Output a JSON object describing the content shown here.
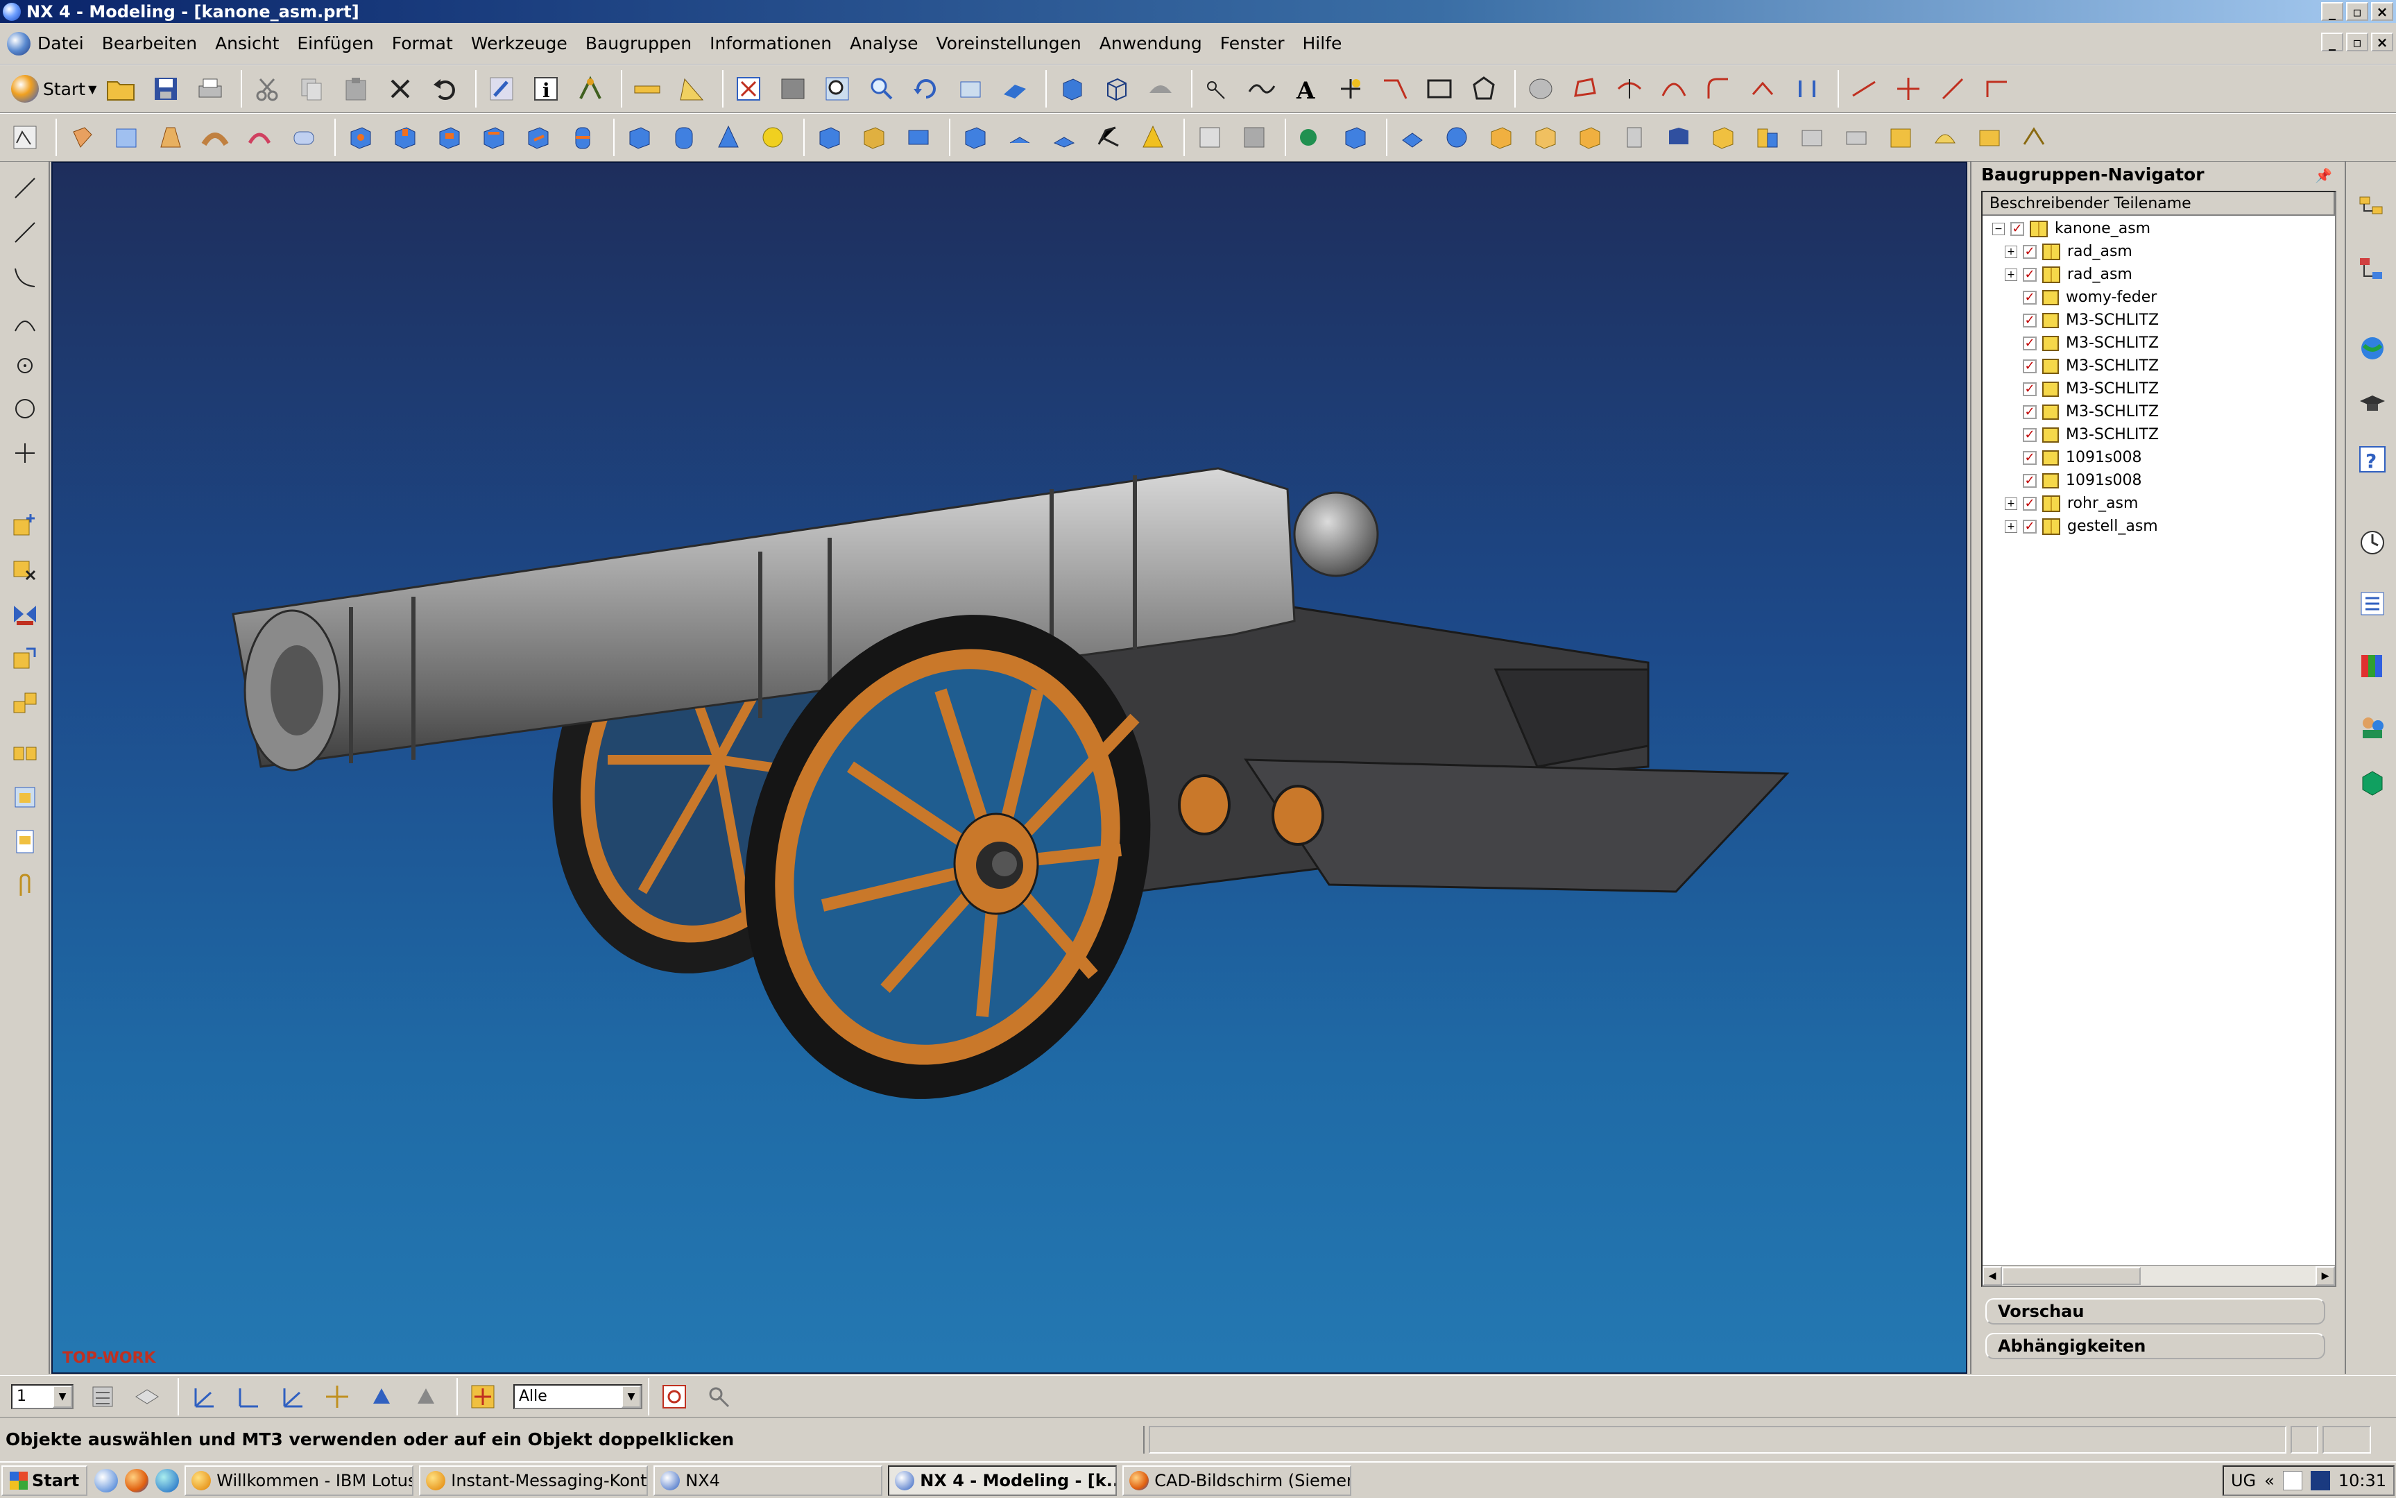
{
  "window": {
    "title": "NX 4 - Modeling - [kanone_asm.prt]",
    "buttons": [
      "_",
      "▫",
      "×"
    ]
  },
  "menu": {
    "items": [
      "Datei",
      "Bearbeiten",
      "Ansicht",
      "Einfügen",
      "Format",
      "Werkzeuge",
      "Baugruppen",
      "Informationen",
      "Analyse",
      "Voreinstellungen",
      "Anwendung",
      "Fenster",
      "Hilfe"
    ]
  },
  "toolbar": {
    "start_label": "Start"
  },
  "viewport": {
    "view_label": "TOP-WORK",
    "background_top": "#1e2e5c",
    "background_bottom": "#2478b2",
    "wheel_color": "#c9782a",
    "barrel_color": "#8a8a8a",
    "carriage_color": "#3a3a3c"
  },
  "navigator": {
    "title": "Baugruppen-Navigator",
    "column_header": "Beschreibender Teilename",
    "tree": [
      {
        "label": "kanone_asm",
        "level": 0,
        "expander": "−",
        "type": "assembly"
      },
      {
        "label": "rad_asm",
        "level": 1,
        "expander": "+",
        "type": "assembly"
      },
      {
        "label": "rad_asm",
        "level": 1,
        "expander": "+",
        "type": "assembly"
      },
      {
        "label": "womy-feder",
        "level": 1,
        "expander": "",
        "type": "part"
      },
      {
        "label": "M3-SCHLITZ",
        "level": 1,
        "expander": "",
        "type": "part"
      },
      {
        "label": "M3-SCHLITZ",
        "level": 1,
        "expander": "",
        "type": "part"
      },
      {
        "label": "M3-SCHLITZ",
        "level": 1,
        "expander": "",
        "type": "part"
      },
      {
        "label": "M3-SCHLITZ",
        "level": 1,
        "expander": "",
        "type": "part"
      },
      {
        "label": "M3-SCHLITZ",
        "level": 1,
        "expander": "",
        "type": "part"
      },
      {
        "label": "M3-SCHLITZ",
        "level": 1,
        "expander": "",
        "type": "part"
      },
      {
        "label": "1091s008",
        "level": 1,
        "expander": "",
        "type": "part"
      },
      {
        "label": "1091s008",
        "level": 1,
        "expander": "",
        "type": "part"
      },
      {
        "label": "rohr_asm",
        "level": 1,
        "expander": "+",
        "type": "assembly"
      },
      {
        "label": "gestell_asm",
        "level": 1,
        "expander": "+",
        "type": "assembly"
      }
    ],
    "sections": [
      "Vorschau",
      "Abhängigkeiten"
    ]
  },
  "selection_bar": {
    "layer_value": "1",
    "filter_value": "Alle"
  },
  "status": {
    "message": "Objekte auswählen und MT3 verwenden oder auf ein Objekt doppelklicken"
  },
  "taskbar": {
    "start_label": "Start",
    "tasks": [
      {
        "label": "Willkommen - IBM Lotus ...",
        "active": false
      },
      {
        "label": "Instant-Messaging-Kontak...",
        "active": false
      },
      {
        "label": "NX4",
        "active": false
      },
      {
        "label": "NX 4 - Modeling - [k...",
        "active": true
      },
      {
        "label": "CAD-Bildschirm (Siemens ...",
        "active": false
      }
    ],
    "tray_lang": "UG",
    "clock": "10:31"
  }
}
